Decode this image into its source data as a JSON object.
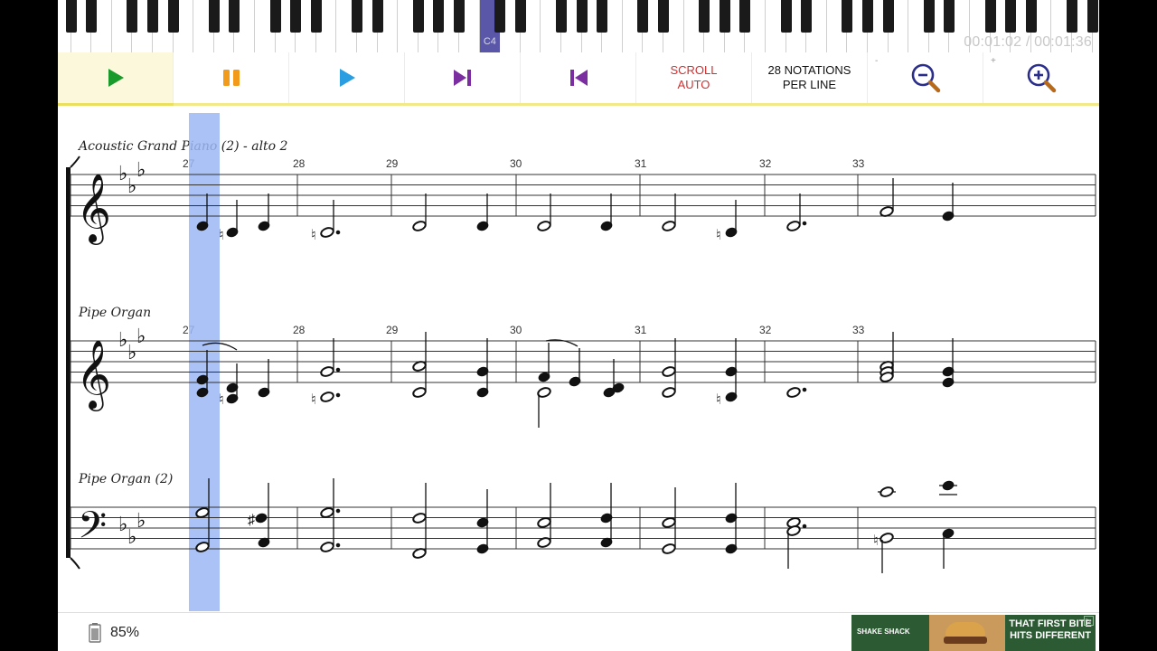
{
  "keyboard": {
    "highlighted_key": "C4"
  },
  "playback": {
    "time": "00:01:02 / 00:01:36"
  },
  "toolbar": {
    "scroll": {
      "line1": "SCROLL",
      "line2": "AUTO"
    },
    "notations": {
      "line1": "28 NOTATIONS",
      "line2": "PER LINE"
    },
    "zoom_out_mini": "-",
    "zoom_in_mini": "+"
  },
  "colors": {
    "play": "#1a9a2b",
    "pause": "#f29a1a",
    "play_from": "#2a9ee0",
    "skip": "#7a2ea0",
    "scroll_text": "#d03030",
    "zoom": "#2a2e8a",
    "playhead": "#9bb7f5",
    "key_highlight": "#5a57a8"
  },
  "icons": {
    "play": "play-icon",
    "pause": "pause-icon",
    "play_from": "play-from-icon",
    "next": "skip-next-icon",
    "prev": "skip-previous-icon",
    "zoom_out": "zoom-out-icon",
    "zoom_in": "zoom-in-icon",
    "battery": "battery-icon"
  },
  "score": {
    "instruments": [
      {
        "name": "Acoustic Grand Piano (2) - alto 2",
        "clef": "treble"
      },
      {
        "name": "Pipe Organ",
        "clef": "treble"
      },
      {
        "name": "Pipe Organ (2)",
        "clef": "bass"
      }
    ],
    "measures": [
      "27",
      "28",
      "29",
      "30",
      "31",
      "32",
      "33"
    ]
  },
  "status": {
    "battery": "85%"
  },
  "ad": {
    "brand": "SHAKE SHACK",
    "tagline": "THAT FIRST BITE HITS DIFFERENT"
  }
}
